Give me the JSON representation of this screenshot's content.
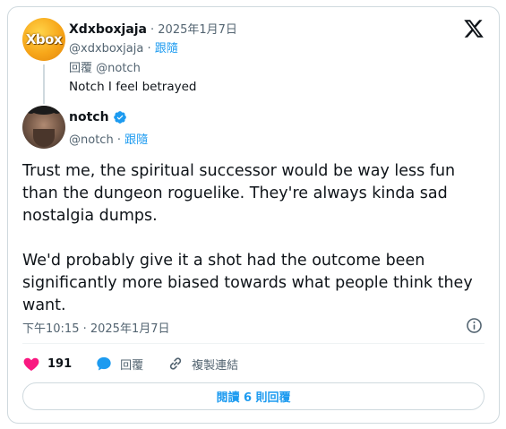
{
  "parent": {
    "avatar_text": "Xbox",
    "name": "Xdxboxjaja",
    "meta": "· 2025年1月7日",
    "handle": "@xdxboxjaja",
    "follow_label": "跟隨",
    "reply_to": "回覆 @notch",
    "text": "Notch I feel betrayed"
  },
  "main": {
    "name": "notch",
    "handle": "@notch",
    "follow_label": "跟隨",
    "paragraph_1": "Trust me, the spiritual successor would be way less fun\nthan the dungeon roguelike. They're always kinda sad\nnostalgia dumps.",
    "paragraph_2": "We'd probably give it a shot had the outcome been\nsignificantly more biased towards what people think they\nwant.",
    "timestamp": "下午10:15 · 2025年1月7日"
  },
  "actions": {
    "like_count": "191",
    "reply_label": "回覆",
    "copy_link_label": "複製連結"
  },
  "read_replies_label": "閱讀 6 則回覆",
  "icons": {
    "logo": "x-logo-icon",
    "verified": "verified-badge-icon",
    "info": "info-icon",
    "like": "heart-icon",
    "reply": "speech-bubble-icon",
    "copy_link": "link-icon"
  },
  "colors": {
    "accent": "#1d9bf0",
    "like": "#f91880",
    "muted": "#536471",
    "border": "#cfd9de"
  }
}
